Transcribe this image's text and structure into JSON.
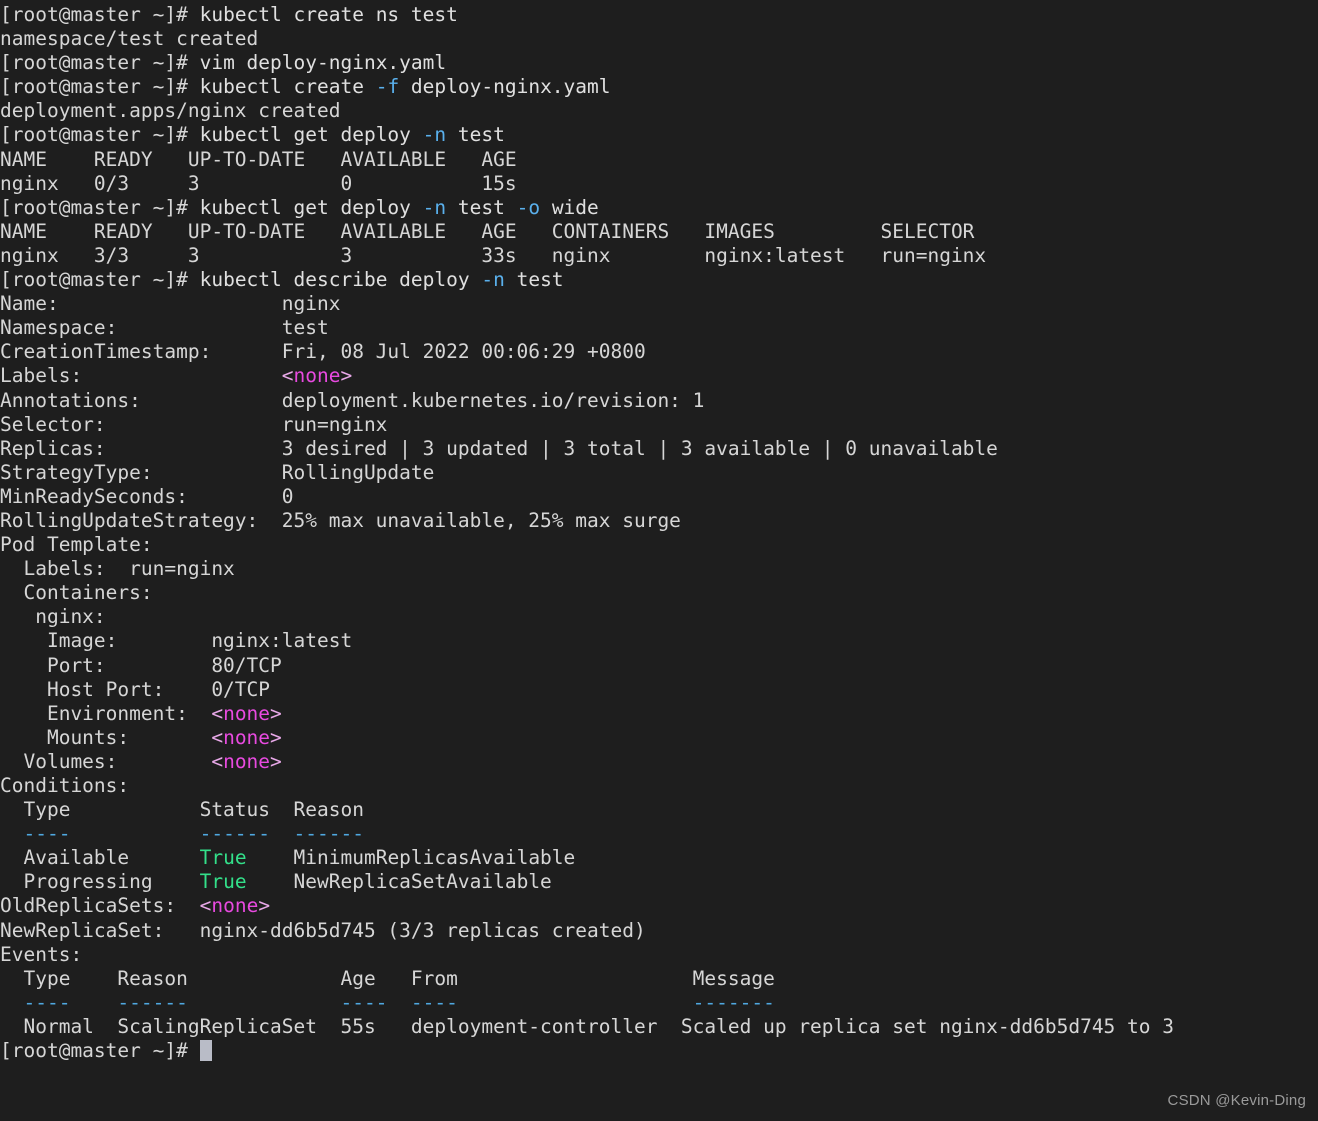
{
  "terminal": {
    "background_color": "#1e1e1e",
    "foreground_color": "#d6d6d6",
    "prompt": "[root@master ~]# ",
    "cursor_color": "#b9bcc7",
    "colors": {
      "flag_cyan": "#5ab0ec",
      "separator_cyan": "#4fa8e0",
      "status_green": "#33e08a",
      "none_magenta": "#e84ae0",
      "angle_bracket_pink": "#e8a8e8"
    },
    "lines": [
      {
        "id": "cmd-create-ns",
        "type": "command",
        "segments": [
          {
            "text": "[root@master ~]# ",
            "color": "default"
          },
          {
            "text": "kubectl create ns test",
            "color": "white"
          }
        ]
      },
      {
        "id": "out-ns-created",
        "type": "output",
        "segments": [
          {
            "text": "namespace/test created",
            "color": "default"
          }
        ]
      },
      {
        "id": "cmd-vim",
        "type": "command",
        "segments": [
          {
            "text": "[root@master ~]# ",
            "color": "default"
          },
          {
            "text": "vim deploy-nginx.yaml",
            "color": "white"
          }
        ]
      },
      {
        "id": "cmd-create-f",
        "type": "command",
        "segments": [
          {
            "text": "[root@master ~]# ",
            "color": "default"
          },
          {
            "text": "kubectl create ",
            "color": "white"
          },
          {
            "text": "-f",
            "color": "flag"
          },
          {
            "text": " deploy-nginx.yaml",
            "color": "white"
          }
        ]
      },
      {
        "id": "out-deploy-created",
        "type": "output",
        "segments": [
          {
            "text": "deployment.apps/nginx created",
            "color": "default"
          }
        ]
      },
      {
        "id": "cmd-get-deploy",
        "type": "command",
        "segments": [
          {
            "text": "[root@master ~]# ",
            "color": "default"
          },
          {
            "text": "kubectl get deploy ",
            "color": "white"
          },
          {
            "text": "-n",
            "color": "flag"
          },
          {
            "text": " test",
            "color": "white"
          }
        ]
      },
      {
        "id": "hdr-get-deploy",
        "type": "output",
        "segments": [
          {
            "text": "NAME    READY   UP-TO-DATE   AVAILABLE   AGE",
            "color": "default"
          }
        ]
      },
      {
        "id": "row-get-deploy",
        "type": "output",
        "segments": [
          {
            "text": "nginx   0/3     3            0           15s",
            "color": "default"
          }
        ]
      },
      {
        "id": "cmd-get-deploy-wide",
        "type": "command",
        "segments": [
          {
            "text": "[root@master ~]# ",
            "color": "default"
          },
          {
            "text": "kubectl get deploy ",
            "color": "white"
          },
          {
            "text": "-n",
            "color": "flag"
          },
          {
            "text": " test ",
            "color": "white"
          },
          {
            "text": "-o",
            "color": "flag"
          },
          {
            "text": " wide",
            "color": "white"
          }
        ]
      },
      {
        "id": "hdr-get-deploy-wide",
        "type": "output",
        "segments": [
          {
            "text": "NAME    READY   UP-TO-DATE   AVAILABLE   AGE   CONTAINERS   IMAGES         SELECTOR",
            "color": "default"
          }
        ]
      },
      {
        "id": "row-get-deploy-wide",
        "type": "output",
        "segments": [
          {
            "text": "nginx   3/3     3            3           33s   nginx        nginx:latest   run=nginx",
            "color": "default"
          }
        ]
      },
      {
        "id": "cmd-describe",
        "type": "command",
        "segments": [
          {
            "text": "[root@master ~]# ",
            "color": "default"
          },
          {
            "text": "kubectl describe deploy ",
            "color": "white"
          },
          {
            "text": "-n",
            "color": "flag"
          },
          {
            "text": " test",
            "color": "white"
          }
        ]
      },
      {
        "id": "desc-name",
        "type": "output",
        "segments": [
          {
            "text": "Name:                   nginx",
            "color": "default"
          }
        ]
      },
      {
        "id": "desc-namespace",
        "type": "output",
        "segments": [
          {
            "text": "Namespace:              test",
            "color": "default"
          }
        ]
      },
      {
        "id": "desc-creationtimestamp",
        "type": "output",
        "segments": [
          {
            "text": "CreationTimestamp:      Fri, 08 Jul 2022 00:06:29 +0800",
            "color": "default"
          }
        ]
      },
      {
        "id": "desc-labels",
        "type": "output",
        "segments": [
          {
            "text": "Labels:                 ",
            "color": "default"
          },
          {
            "text": "<",
            "color": "bracket"
          },
          {
            "text": "none",
            "color": "magenta"
          },
          {
            "text": ">",
            "color": "bracket"
          }
        ]
      },
      {
        "id": "desc-annotations",
        "type": "output",
        "segments": [
          {
            "text": "Annotations:            deployment.kubernetes.io/revision: 1",
            "color": "default"
          }
        ]
      },
      {
        "id": "desc-selector",
        "type": "output",
        "segments": [
          {
            "text": "Selector:               run=nginx",
            "color": "default"
          }
        ]
      },
      {
        "id": "desc-replicas",
        "type": "output",
        "segments": [
          {
            "text": "Replicas:               3 desired | 3 updated | 3 total | 3 available | 0 unavailable",
            "color": "default"
          }
        ]
      },
      {
        "id": "desc-strategytype",
        "type": "output",
        "segments": [
          {
            "text": "StrategyType:           RollingUpdate",
            "color": "default"
          }
        ]
      },
      {
        "id": "desc-minreadyseconds",
        "type": "output",
        "segments": [
          {
            "text": "MinReadySeconds:        0",
            "color": "default"
          }
        ]
      },
      {
        "id": "desc-rollingupdatestrategy",
        "type": "output",
        "segments": [
          {
            "text": "RollingUpdateStrategy:  25% max unavailable, 25% max surge",
            "color": "default"
          }
        ]
      },
      {
        "id": "desc-podtemplate",
        "type": "output",
        "segments": [
          {
            "text": "Pod Template:",
            "color": "default"
          }
        ]
      },
      {
        "id": "desc-pod-labels",
        "type": "output",
        "segments": [
          {
            "text": "  Labels:  run=nginx",
            "color": "default"
          }
        ]
      },
      {
        "id": "desc-containers",
        "type": "output",
        "segments": [
          {
            "text": "  Containers:",
            "color": "default"
          }
        ]
      },
      {
        "id": "desc-container-nginx",
        "type": "output",
        "segments": [
          {
            "text": "   nginx:",
            "color": "default"
          }
        ]
      },
      {
        "id": "desc-image",
        "type": "output",
        "segments": [
          {
            "text": "    Image:        nginx:latest",
            "color": "default"
          }
        ]
      },
      {
        "id": "desc-port",
        "type": "output",
        "segments": [
          {
            "text": "    Port:         80/TCP",
            "color": "default"
          }
        ]
      },
      {
        "id": "desc-hostport",
        "type": "output",
        "segments": [
          {
            "text": "    Host Port:    0/TCP",
            "color": "default"
          }
        ]
      },
      {
        "id": "desc-environment",
        "type": "output",
        "segments": [
          {
            "text": "    Environment:  ",
            "color": "default"
          },
          {
            "text": "<",
            "color": "bracket"
          },
          {
            "text": "none",
            "color": "magenta"
          },
          {
            "text": ">",
            "color": "bracket"
          }
        ]
      },
      {
        "id": "desc-mounts",
        "type": "output",
        "segments": [
          {
            "text": "    Mounts:       ",
            "color": "default"
          },
          {
            "text": "<",
            "color": "bracket"
          },
          {
            "text": "none",
            "color": "magenta"
          },
          {
            "text": ">",
            "color": "bracket"
          }
        ]
      },
      {
        "id": "desc-volumes",
        "type": "output",
        "segments": [
          {
            "text": "  Volumes:        ",
            "color": "default"
          },
          {
            "text": "<",
            "color": "bracket"
          },
          {
            "text": "none",
            "color": "magenta"
          },
          {
            "text": ">",
            "color": "bracket"
          }
        ]
      },
      {
        "id": "desc-conditions",
        "type": "output",
        "segments": [
          {
            "text": "Conditions:",
            "color": "default"
          }
        ]
      },
      {
        "id": "cond-header",
        "type": "output",
        "segments": [
          {
            "text": "  Type           Status  Reason",
            "color": "default"
          }
        ]
      },
      {
        "id": "cond-sep",
        "type": "output",
        "segments": [
          {
            "text": "  ",
            "color": "default"
          },
          {
            "text": "----           ------  ------",
            "color": "separator"
          }
        ]
      },
      {
        "id": "cond-available",
        "type": "output",
        "segments": [
          {
            "text": "  Available      ",
            "color": "default"
          },
          {
            "text": "True",
            "color": "green"
          },
          {
            "text": "    MinimumReplicasAvailable",
            "color": "default"
          }
        ]
      },
      {
        "id": "cond-progressing",
        "type": "output",
        "segments": [
          {
            "text": "  Progressing    ",
            "color": "default"
          },
          {
            "text": "True",
            "color": "green"
          },
          {
            "text": "    NewReplicaSetAvailable",
            "color": "default"
          }
        ]
      },
      {
        "id": "desc-oldreplicasets",
        "type": "output",
        "segments": [
          {
            "text": "OldReplicaSets:  ",
            "color": "default"
          },
          {
            "text": "<",
            "color": "bracket"
          },
          {
            "text": "none",
            "color": "magenta"
          },
          {
            "text": ">",
            "color": "bracket"
          }
        ]
      },
      {
        "id": "desc-newreplicaset",
        "type": "output",
        "segments": [
          {
            "text": "NewReplicaSet:   nginx-dd6b5d745 (3/3 replicas created)",
            "color": "default"
          }
        ]
      },
      {
        "id": "desc-events",
        "type": "output",
        "segments": [
          {
            "text": "Events:",
            "color": "default"
          }
        ]
      },
      {
        "id": "events-header",
        "type": "output",
        "segments": [
          {
            "text": "  Type    Reason             Age   From                    Message",
            "color": "default"
          }
        ]
      },
      {
        "id": "events-sep",
        "type": "output",
        "segments": [
          {
            "text": "  ",
            "color": "default"
          },
          {
            "text": "----    ------             ----  ----                    -------",
            "color": "separator"
          }
        ]
      },
      {
        "id": "events-row-1",
        "type": "output",
        "segments": [
          {
            "text": "  Normal  ScalingReplicaSet  55s   deployment-controller  Scaled up replica set nginx-dd6b5d745 to 3",
            "color": "default"
          }
        ]
      },
      {
        "id": "prompt-final",
        "type": "command",
        "segments": [
          {
            "text": "[root@master ~]# ",
            "color": "default"
          },
          {
            "text": "",
            "color": "cursor"
          }
        ]
      }
    ]
  },
  "watermark": {
    "text": "CSDN @Kevin-Ding"
  }
}
